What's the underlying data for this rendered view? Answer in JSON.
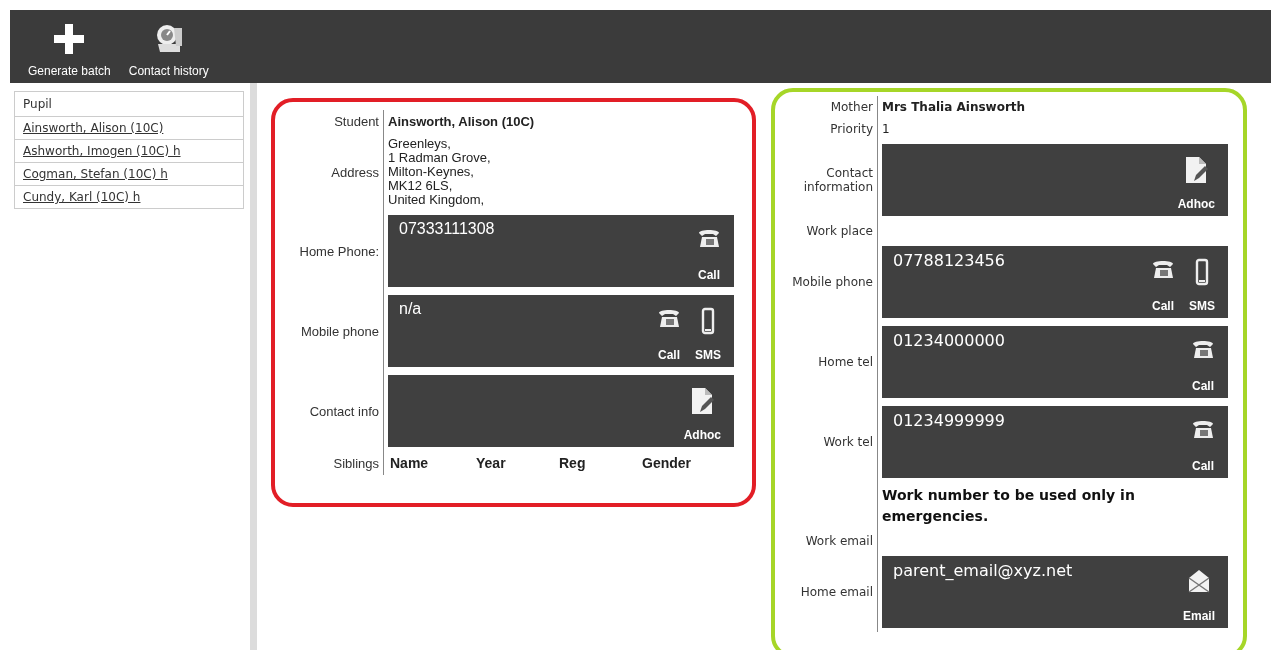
{
  "toolbar": [
    {
      "kind": "add",
      "label": "Generate batch"
    },
    {
      "kind": "history",
      "label": "Contact history"
    }
  ],
  "pupil_list": {
    "header": "Pupil",
    "items": [
      "Ainsworth, Alison (10C)",
      "Ashworth, Imogen (10C) h",
      "Cogman, Stefan (10C) h",
      "Cundy, Karl (10C) h"
    ]
  },
  "student_panel": {
    "rows": [
      {
        "kind": "bold",
        "label": "Student",
        "value": "Ainsworth, Alison (10C)"
      },
      {
        "kind": "lines",
        "label": "Address",
        "lines": [
          "Greenleys,",
          "1 Radman Grove,",
          "Milton-Keynes,",
          "MK12 6LS,",
          "United Kingdom,"
        ]
      },
      {
        "kind": "tile",
        "label": "Home Phone:",
        "value": "07333111308",
        "actions": [
          {
            "kind": "call",
            "label": "Call"
          }
        ]
      },
      {
        "kind": "tile",
        "label": "Mobile phone",
        "value": "n/a",
        "actions": [
          {
            "kind": "call",
            "label": "Call"
          },
          {
            "kind": "sms",
            "label": "SMS"
          }
        ]
      },
      {
        "kind": "tile",
        "label": "Contact info",
        "actions": [
          {
            "kind": "adhoc",
            "label": "Adhoc"
          }
        ]
      },
      {
        "kind": "columns",
        "label": "Siblings",
        "columns": [
          "Name",
          "Year",
          "Reg",
          "Gender"
        ]
      }
    ]
  },
  "contact_panel": {
    "rows": [
      {
        "kind": "bold",
        "label": "Mother",
        "value": "Mrs Thalia Ainsworth"
      },
      {
        "kind": "text",
        "label": "Priority",
        "value": "1"
      },
      {
        "kind": "tile",
        "label": "Contact information",
        "actions": [
          {
            "kind": "adhoc",
            "label": "Adhoc"
          }
        ]
      },
      {
        "kind": "text",
        "label": "Work place"
      },
      {
        "kind": "tile",
        "label": "Mobile phone",
        "value": "07788123456",
        "actions": [
          {
            "kind": "call",
            "label": "Call"
          },
          {
            "kind": "sms",
            "label": "SMS"
          }
        ]
      },
      {
        "kind": "tile",
        "label": "Home tel",
        "value": "01234000000",
        "actions": [
          {
            "kind": "call",
            "label": "Call"
          }
        ]
      },
      {
        "kind": "tile",
        "label": "Work tel",
        "value": "01234999999",
        "actions": [
          {
            "kind": "call",
            "label": "Call"
          }
        ]
      },
      {
        "kind": "note",
        "value": "Work number to be used only in emergencies."
      },
      {
        "kind": "text",
        "label": "Work email"
      },
      {
        "kind": "tile",
        "label": "Home email",
        "value": "parent_email@xyz.net",
        "actions": [
          {
            "kind": "email",
            "label": "Email"
          }
        ]
      }
    ]
  }
}
